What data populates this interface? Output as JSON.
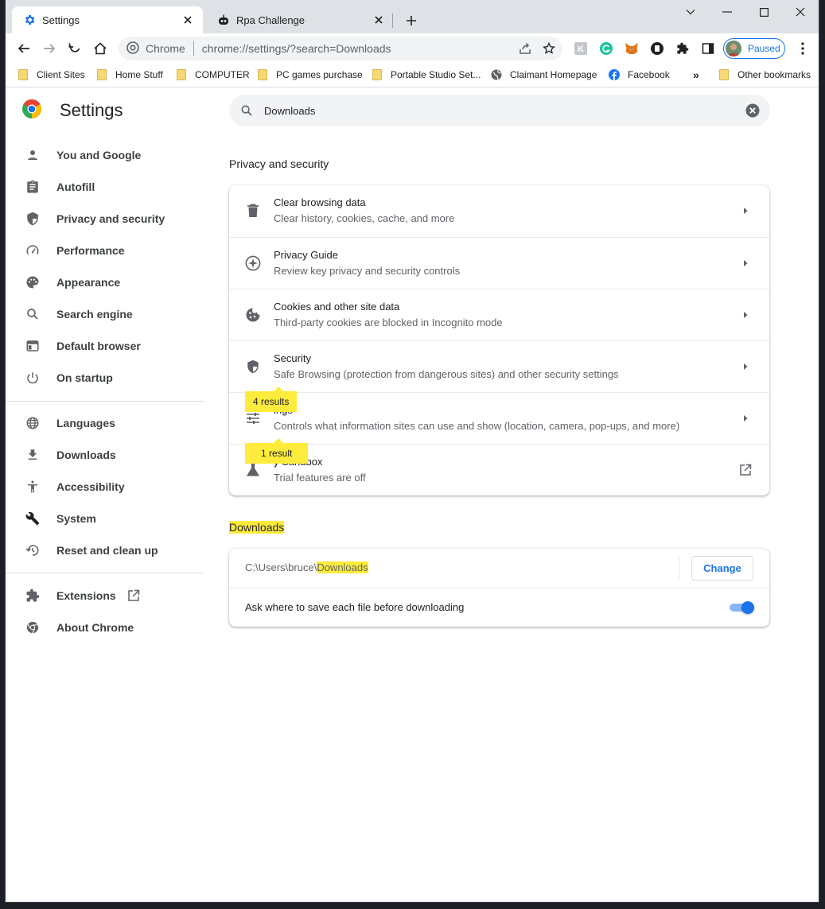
{
  "tabs": [
    {
      "label": "Settings",
      "icon": "gear-icon"
    },
    {
      "label": "Rpa Challenge",
      "icon": "robot-icon"
    }
  ],
  "toolbar": {
    "site_chip": "Chrome",
    "url": "chrome://settings/?search=Downloads",
    "profile_label": "Paused"
  },
  "bookmarks": {
    "items": [
      {
        "label": "Client Sites",
        "icon": "folder-icon"
      },
      {
        "label": "Home Stuff",
        "icon": "folder-icon"
      },
      {
        "label": "COMPUTER",
        "icon": "folder-icon"
      },
      {
        "label": "PC games purchase",
        "icon": "folder-icon"
      },
      {
        "label": "Portable Studio Set...",
        "icon": "folder-icon"
      },
      {
        "label": "Claimant Homepage",
        "icon": "globe-icon"
      },
      {
        "label": "Facebook",
        "icon": "facebook-icon"
      }
    ],
    "overflow": "»",
    "other": "Other bookmarks"
  },
  "settings": {
    "title": "Settings",
    "search_value": "Downloads",
    "nav": [
      {
        "label": "You and Google",
        "icon": "person-icon"
      },
      {
        "label": "Autofill",
        "icon": "clipboard-icon"
      },
      {
        "label": "Privacy and security",
        "icon": "shield-icon"
      },
      {
        "label": "Performance",
        "icon": "speedometer-icon"
      },
      {
        "label": "Appearance",
        "icon": "palette-icon"
      },
      {
        "label": "Search engine",
        "icon": "search-icon"
      },
      {
        "label": "Default browser",
        "icon": "browser-icon"
      },
      {
        "label": "On startup",
        "icon": "power-icon"
      },
      {
        "label": "Languages",
        "icon": "globe-icon"
      },
      {
        "label": "Downloads",
        "icon": "download-icon"
      },
      {
        "label": "Accessibility",
        "icon": "accessibility-icon"
      },
      {
        "label": "System",
        "icon": "wrench-icon"
      },
      {
        "label": "Reset and clean up",
        "icon": "restore-icon"
      },
      {
        "label": "Extensions",
        "icon": "puzzle-icon"
      },
      {
        "label": "About Chrome",
        "icon": "chrome-icon"
      }
    ]
  },
  "privacy": {
    "section_title": "Privacy and security",
    "rows": [
      {
        "title": "Clear browsing data",
        "subtitle": "Clear history, cookies, cache, and more",
        "icon": "trash-icon"
      },
      {
        "title": "Privacy Guide",
        "subtitle": "Review key privacy and security controls",
        "icon": "compass-icon"
      },
      {
        "title": "Cookies and other site data",
        "subtitle": "Third-party cookies are blocked in Incognito mode",
        "icon": "cookie-icon"
      },
      {
        "title": "Security",
        "subtitle": "Safe Browsing (protection from dangerous sites) and other security settings",
        "icon": "shield-icon"
      },
      {
        "title": "ings",
        "subtitle": "Controls what information sites can use and show (location, camera, pop-ups, and more)",
        "icon": "sliders-icon"
      },
      {
        "title": "y Sandbox",
        "subtitle": "Trial features are off",
        "icon": "flask-icon"
      }
    ],
    "bubble_site_settings": "4 results",
    "bubble_sandbox": "1 result"
  },
  "downloads": {
    "section_title": "Downloads",
    "location_prefix": "C:\\Users\\bruce\\",
    "location_highlight": "Downloads",
    "change_label": "Change",
    "ask_label": "Ask where to save each file before downloading",
    "ask_enabled": true
  },
  "colors": {
    "accent": "#1a73e8",
    "highlight": "#ffeb3b"
  }
}
